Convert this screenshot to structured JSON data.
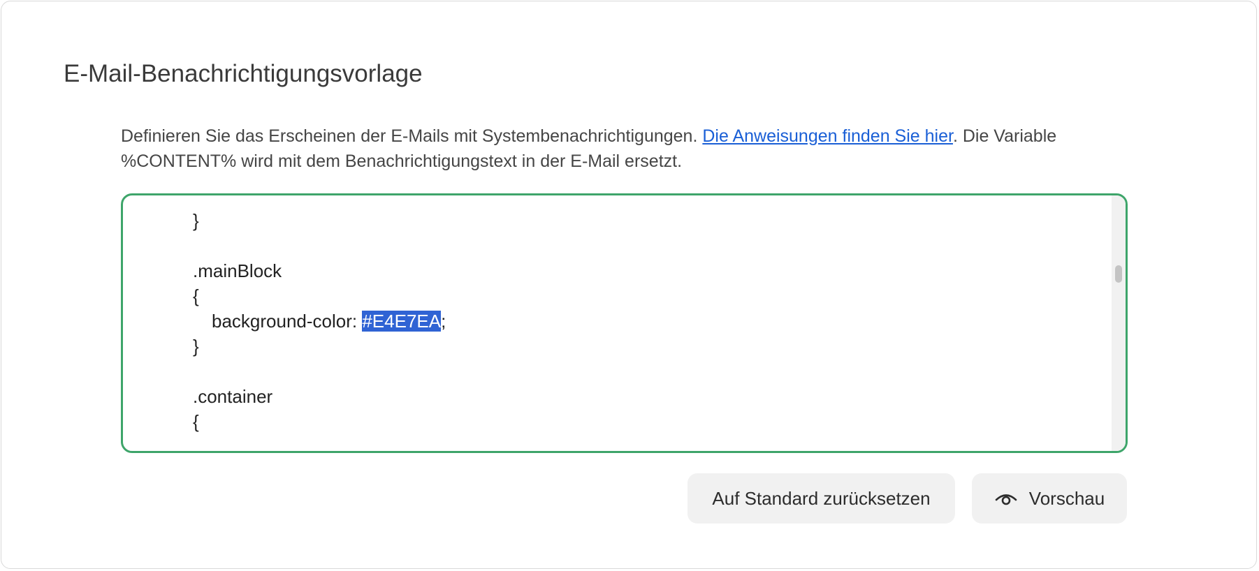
{
  "section": {
    "title": "E-Mail-Benachrichtigungsvorlage",
    "description_before": "Definieren Sie das Erscheinen der E-Mails mit Systembenachrichtigungen. ",
    "description_link": "Die Anweisungen finden Sie hier",
    "description_after": ". Die Variable %CONTENT% wird mit dem Benachrichtigungstext in der E-Mail ersetzt."
  },
  "editor": {
    "lines": {
      "l1": "}",
      "l2": "",
      "l3": ".mainBlock",
      "l4": "{",
      "l5_prefix": "background-color: ",
      "l5_selected": "#E4E7EA",
      "l5_suffix": ";",
      "l6": "}",
      "l7": "",
      "l8": ".container",
      "l9": "{"
    }
  },
  "actions": {
    "reset_label": "Auf Standard zurücksetzen",
    "preview_label": "Vorschau",
    "preview_icon": "eye-icon"
  },
  "colors": {
    "editor_border": "#3ea56a",
    "selection": "#2f63d4",
    "link": "#1a5fd6"
  }
}
